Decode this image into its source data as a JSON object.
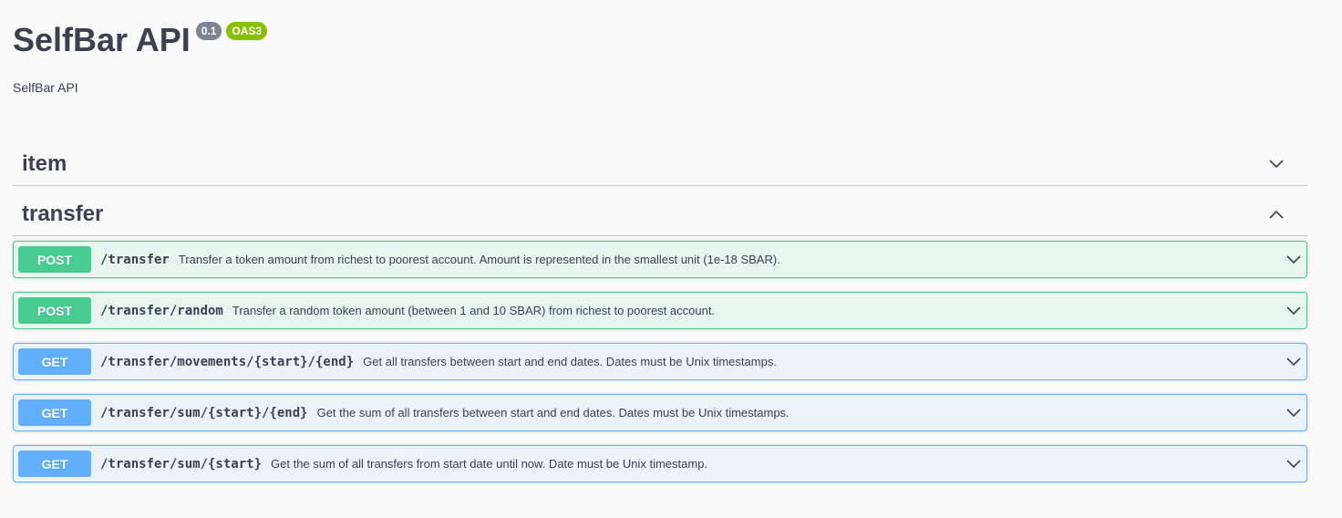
{
  "info": {
    "title": "SelfBar API",
    "version_badge": "0.1",
    "oas_badge": "OAS3",
    "description": "SelfBar API"
  },
  "tags": [
    {
      "name": "item",
      "expanded": false,
      "icon": "chevron-down-icon"
    },
    {
      "name": "transfer",
      "expanded": true,
      "icon": "chevron-up-icon"
    }
  ],
  "operations": [
    {
      "method": "POST",
      "path": "/transfer",
      "summary": "Transfer a token amount from richest to poorest account. Amount is represented in the smallest unit (1e-18 SBAR)."
    },
    {
      "method": "POST",
      "path": "/transfer/random",
      "summary": "Transfer a random token amount (between 1 and 10 SBAR) from richest to poorest account."
    },
    {
      "method": "GET",
      "path": "/transfer/movements/{start}/{end}",
      "summary": "Get all transfers between start and end dates. Dates must be Unix timestamps."
    },
    {
      "method": "GET",
      "path": "/transfer/sum/{start}/{end}",
      "summary": "Get the sum of all transfers between start and end dates. Dates must be Unix timestamps."
    },
    {
      "method": "GET",
      "path": "/transfer/sum/{start}",
      "summary": "Get the sum of all transfers from start date until now. Date must be Unix timestamp."
    }
  ],
  "colors": {
    "post": "#49cc90",
    "get": "#61affe",
    "text": "#3b4151",
    "version_badge": "#7d8492",
    "oas_badge": "#89bf04"
  }
}
